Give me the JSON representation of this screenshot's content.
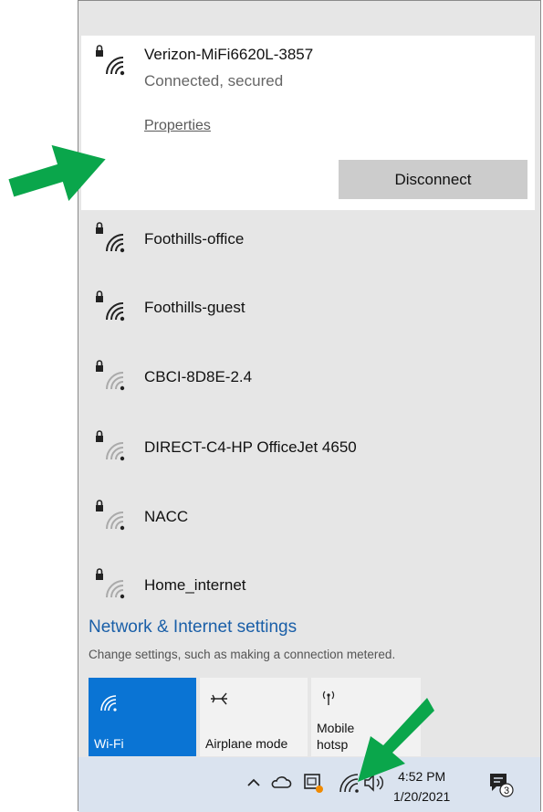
{
  "connected_network": {
    "name": "Verizon-MiFi6620L-3857",
    "status": "Connected, secured",
    "properties_label": "Properties",
    "disconnect_label": "Disconnect"
  },
  "networks": [
    {
      "name": "Foothills-office",
      "signal": "strong",
      "secured": true
    },
    {
      "name": "Foothills-guest",
      "signal": "strong",
      "secured": true
    },
    {
      "name": "CBCI-8D8E-2.4",
      "signal": "weak",
      "secured": true
    },
    {
      "name": "DIRECT-C4-HP OfficeJet 4650",
      "signal": "weak",
      "secured": true
    },
    {
      "name": "NACC",
      "signal": "weak",
      "secured": true
    },
    {
      "name": "Home_internet",
      "signal": "weak",
      "secured": true
    }
  ],
  "settings": {
    "title": "Network & Internet settings",
    "description": "Change settings, such as making a connection metered."
  },
  "quick_actions": [
    {
      "label": "Wi-Fi",
      "icon": "wifi-icon",
      "active": true
    },
    {
      "label": "Airplane mode",
      "icon": "airplane-icon",
      "active": false
    },
    {
      "label": "Mobile hotsp",
      "label_line1": "Mobile",
      "label_line2": "hotsp",
      "icon": "hotspot-icon",
      "active": false
    }
  ],
  "taskbar": {
    "time": "4:52 PM",
    "date": "1/20/2021",
    "notification_count": "3"
  },
  "colors": {
    "accent": "#0a74d4",
    "link": "#1a5fa8",
    "arrow": "#0aa64b"
  }
}
